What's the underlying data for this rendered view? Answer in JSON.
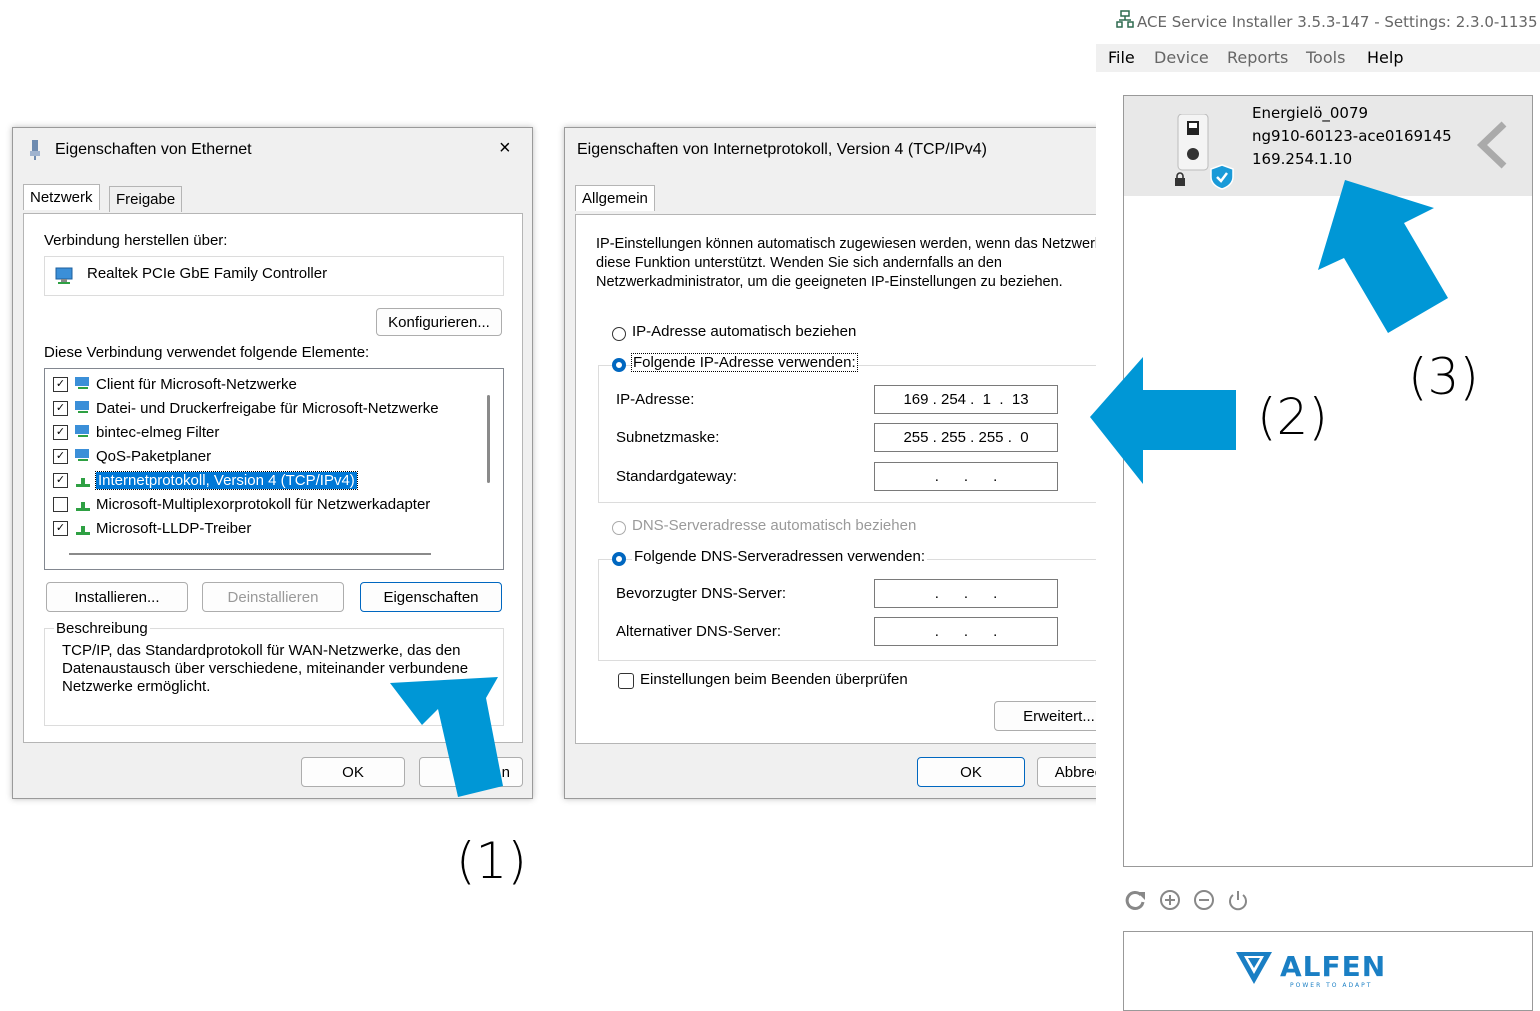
{
  "dlg1": {
    "title": "Eigenschaften von Ethernet",
    "close": "×",
    "tabs": [
      "Netzwerk",
      "Freigabe"
    ],
    "connect_label": "Verbindung herstellen über:",
    "adapter": "Realtek PCIe GbE Family Controller",
    "configure": "Konfigurieren...",
    "elements_label": "Diese Verbindung verwendet folgende Elemente:",
    "items": [
      {
        "label": "Client für Microsoft-Netzwerke",
        "checked": "✓"
      },
      {
        "label": "Datei- und Druckerfreigabe für Microsoft-Netzwerke",
        "checked": "✓"
      },
      {
        "label": "bintec-elmeg Filter",
        "checked": "✓"
      },
      {
        "label": "QoS-Paketplaner",
        "checked": "✓"
      },
      {
        "label": "Internetprotokoll, Version 4 (TCP/IPv4)",
        "checked": "✓"
      },
      {
        "label": "Microsoft-Multiplexorprotokoll für Netzwerkadapter",
        "checked": ""
      },
      {
        "label": "Microsoft-LLDP-Treiber",
        "checked": "✓"
      }
    ],
    "install": "Installieren...",
    "uninstall": "Deinstallieren",
    "properties": "Eigenschaften",
    "description_title": "Beschreibung",
    "description_text": "TCP/IP, das Standardprotokoll für WAN-Netzwerke, das den Datenaustausch über verschiedene, miteinander verbundene Netzwerke ermöglicht.",
    "ok": "OK",
    "cancel_partial": "n"
  },
  "dlg2": {
    "title": "Eigenschaften von Internetprotokoll, Version 4 (TCP/IPv4)",
    "close": "×",
    "tab": "Allgemein",
    "intro": "IP-Einstellungen können automatisch zugewiesen werden, wenn das Netzwerk diese Funktion unterstützt. Wenden Sie sich andernfalls an den Netzwerkadministrator, um die geeigneten IP-Einstellungen zu beziehen.",
    "ip_auto": "IP-Adresse automatisch beziehen",
    "ip_manual": "Folgende IP-Adresse verwenden:",
    "ip_label": "IP-Adresse:",
    "ip_value": "169 . 254 .  1  .  13",
    "mask_label": "Subnetzmaske:",
    "mask_value": "255 . 255 . 255 .  0",
    "gw_label": "Standardgateway:",
    "gw_value": ".      .      .",
    "dns_auto": "DNS-Serveradresse automatisch beziehen",
    "dns_manual": "Folgende DNS-Serveradressen verwenden:",
    "dns_pref_label": "Bevorzugter DNS-Server:",
    "dns_pref_value": ".      .      .",
    "dns_alt_label": "Alternativer DNS-Server:",
    "dns_alt_value": ".      .      .",
    "validate": "Einstellungen beim Beenden überprüfen",
    "advanced": "Erweitert...",
    "ok": "OK",
    "cancel": "Abbrechen"
  },
  "ace": {
    "title": "ACE Service Installer 3.5.3-147 - Settings: 2.3.0-1135",
    "menu": [
      "File",
      "Device",
      "Reports",
      "Tools",
      "Help"
    ],
    "device_name": "Energielö_0079",
    "device_id": "ng910-60123-ace0169145",
    "device_ip": "169.254.1.10",
    "logo_text": "ALFEN",
    "logo_tagline": "POWER TO ADAPT"
  },
  "annotations": [
    "(1)",
    "(2)",
    "(3)"
  ],
  "colors": {
    "arrow": "#0097d6",
    "accent": "#0067c0",
    "selection": "#0078d7"
  }
}
